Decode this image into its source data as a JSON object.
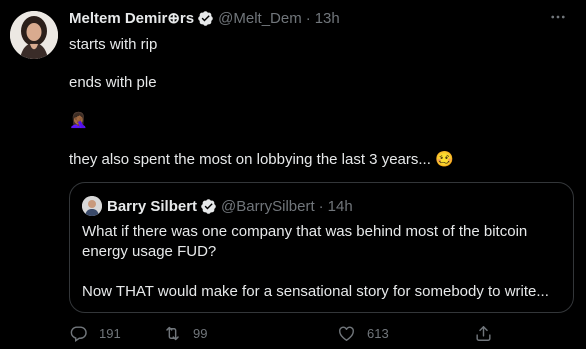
{
  "tweet": {
    "author_name": "Meltem Demir⊕rs",
    "handle": "@Melt_Dem",
    "separator": "·",
    "time": "13h",
    "lines": [
      "starts with rip",
      "ends with ple",
      "🤦🏾‍♀️",
      "they also spent the most on lobbying the last 3 years..."
    ],
    "trailing_emoji": "🥴"
  },
  "quoted": {
    "author_name": "Barry Silbert",
    "handle": "@BarrySilbert",
    "separator": "·",
    "time": "14h",
    "lines": [
      "What if there was one company that was behind most of the bitcoin",
      "energy usage FUD?",
      "Now THAT would make for a sensational story for somebody to write..."
    ]
  },
  "actions": {
    "reply_count": "191",
    "retweet_count": "99",
    "like_count": "613"
  },
  "colors": {
    "background": "#000000",
    "text": "#e7e9ea",
    "secondary": "#71767b",
    "border": "#333639"
  },
  "icons": [
    "avatar",
    "verified-badge-icon",
    "more-icon",
    "reply-icon",
    "retweet-icon",
    "like-icon",
    "share-icon"
  ]
}
